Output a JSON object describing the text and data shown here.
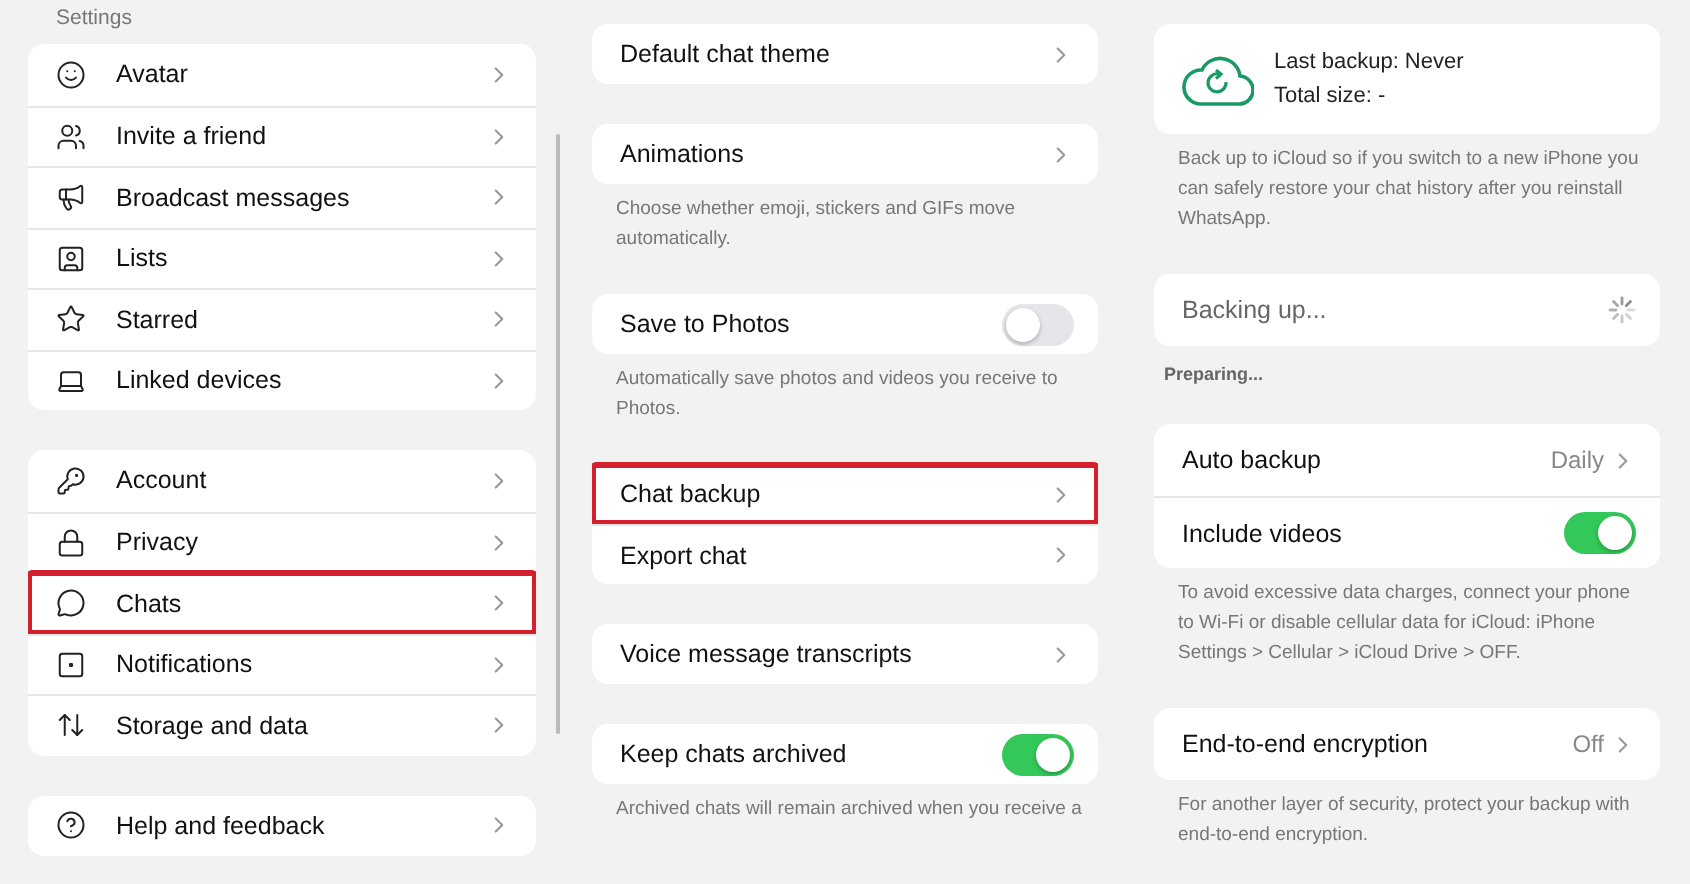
{
  "columns": [
    {
      "heading": "Settings",
      "groups": [
        {
          "items": [
            {
              "kind": "link",
              "label": "Avatar",
              "highlighted": false
            },
            {
              "kind": "link",
              "label": "Invite a friend",
              "highlighted": false
            },
            {
              "kind": "link",
              "label": "Broadcast messages",
              "highlighted": false
            },
            {
              "kind": "link",
              "label": "Lists",
              "highlighted": false
            },
            {
              "kind": "link",
              "label": "Starred",
              "highlighted": false
            },
            {
              "kind": "link",
              "label": "Linked devices",
              "highlighted": false
            }
          ]
        },
        {
          "items": [
            {
              "kind": "link",
              "label": "Account",
              "highlighted": false
            },
            {
              "kind": "link",
              "label": "Privacy",
              "highlighted": false
            },
            {
              "kind": "link",
              "label": "Chats",
              "highlighted": true
            },
            {
              "kind": "link",
              "label": "Notifications",
              "highlighted": false
            },
            {
              "kind": "link",
              "label": "Storage and data",
              "highlighted": false
            }
          ]
        },
        {
          "items": [
            {
              "kind": "link",
              "label": "Help and feedback",
              "highlighted": false
            }
          ]
        }
      ]
    },
    {
      "groups": [
        {
          "items": [
            {
              "kind": "link",
              "label": "Default chat theme",
              "highlighted": false
            }
          ]
        },
        {
          "items": [
            {
              "kind": "link",
              "label": "Animations",
              "highlighted": false
            }
          ],
          "caption": "Choose whether emoji, stickers and GIFs move automatically."
        },
        {
          "items": [
            {
              "kind": "toggle",
              "label": "Save to Photos",
              "on": false
            }
          ],
          "caption": "Automatically save photos and videos you receive to Photos."
        },
        {
          "items": [
            {
              "kind": "link",
              "label": "Chat backup",
              "highlighted": true
            },
            {
              "kind": "link",
              "label": "Export chat",
              "highlighted": false
            }
          ]
        },
        {
          "items": [
            {
              "kind": "link",
              "label": "Voice message transcripts",
              "highlighted": false
            }
          ]
        },
        {
          "items": [
            {
              "kind": "toggle",
              "label": "Keep chats archived",
              "on": true
            }
          ],
          "caption": "Archived chats will remain archived when you receive a"
        }
      ]
    },
    {
      "groups": [
        {
          "items": [
            {
              "kind": "backup_info",
              "lines": [
                "Last backup: Never",
                "Total size: -"
              ]
            }
          ],
          "caption": "Back up to iCloud so if you switch to a new iPhone you can safely restore your chat history after you reinstall WhatsApp."
        },
        {
          "items": [
            {
              "kind": "progress",
              "label": "Backing up..."
            }
          ],
          "note": "Preparing..."
        },
        {
          "items": [
            {
              "kind": "link",
              "label": "Auto backup",
              "value": "Daily",
              "highlighted": false
            },
            {
              "kind": "toggle",
              "label": "Include videos",
              "on": true
            }
          ],
          "caption": "To avoid excessive data charges, connect your phone to Wi-Fi or disable cellular data for iCloud: iPhone Settings > Cellular > iCloud Drive > OFF."
        },
        {
          "items": [
            {
              "kind": "link",
              "label": "End-to-end encryption",
              "value": "Off",
              "highlighted": false
            }
          ],
          "caption": "For another layer of security, protect your backup with end-to-end encryption."
        }
      ]
    }
  ]
}
